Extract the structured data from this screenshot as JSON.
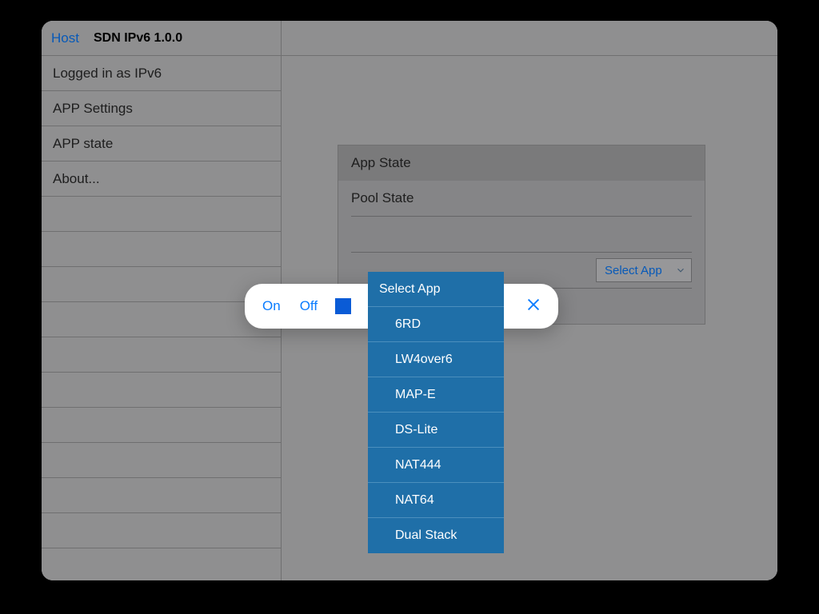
{
  "header": {
    "host_label": "Host",
    "title": "SDN IPv6 1.0.0"
  },
  "sidebar": {
    "items": [
      {
        "label": "Logged in as IPv6"
      },
      {
        "label": "APP Settings"
      },
      {
        "label": "APP state"
      },
      {
        "label": "About..."
      },
      {
        "label": ""
      },
      {
        "label": ""
      },
      {
        "label": ""
      },
      {
        "label": ""
      },
      {
        "label": ""
      },
      {
        "label": ""
      },
      {
        "label": ""
      },
      {
        "label": ""
      },
      {
        "label": ""
      },
      {
        "label": ""
      }
    ]
  },
  "card": {
    "header": "App State",
    "pool_state_label": "Pool State",
    "select_placeholder": "Select App"
  },
  "popover": {
    "on_label": "On",
    "off_label": "Off"
  },
  "dropdown": {
    "header": "Select App",
    "items": [
      "6RD",
      "LW4over6",
      "MAP-E",
      "DS-Lite",
      "NAT444",
      "NAT64",
      "Dual Stack"
    ]
  }
}
